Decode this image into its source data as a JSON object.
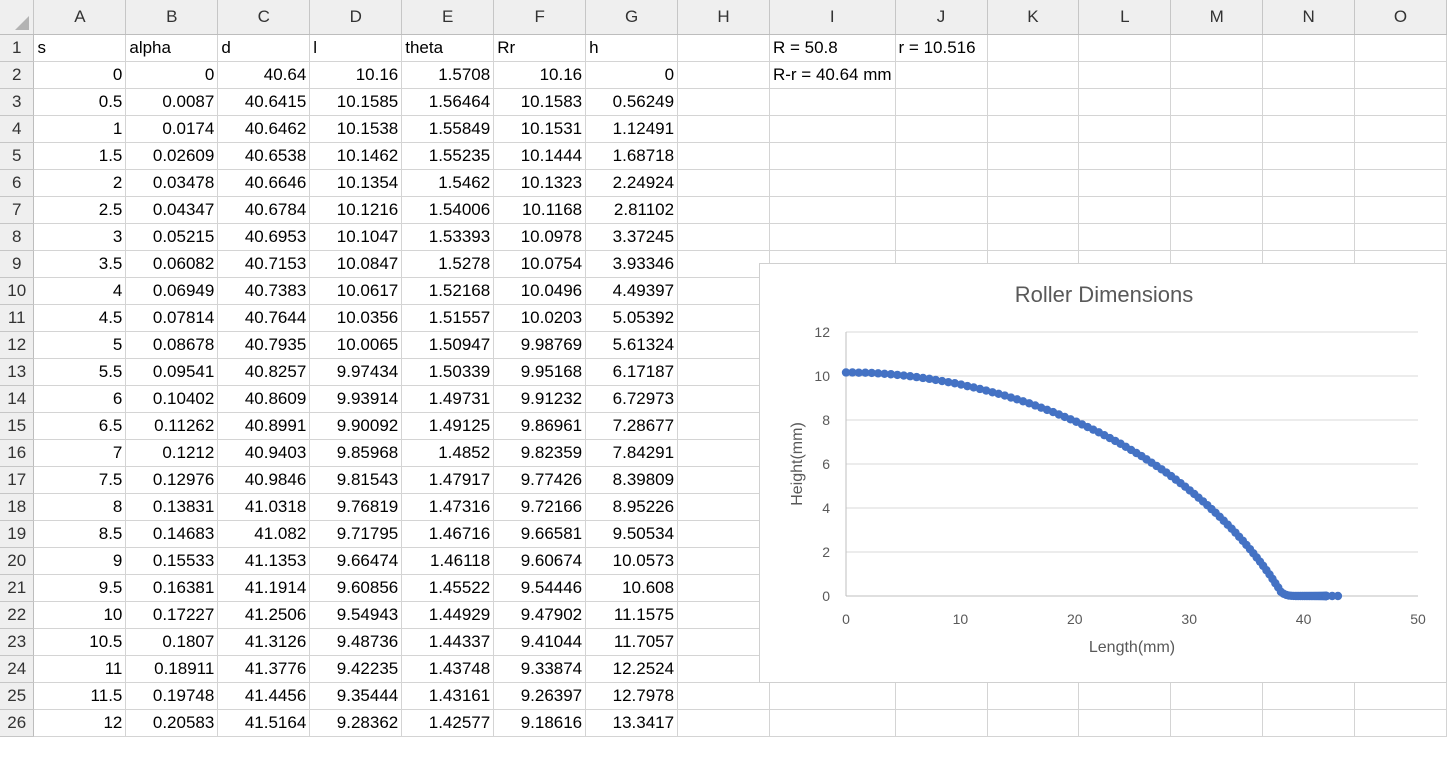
{
  "columns": [
    "A",
    "B",
    "C",
    "D",
    "E",
    "F",
    "G",
    "H",
    "I",
    "J",
    "K",
    "L",
    "M",
    "N",
    "O"
  ],
  "header_row": [
    "s",
    "alpha",
    "d",
    "l",
    "theta",
    "Rr",
    "h"
  ],
  "notes": {
    "I1": "R = 50.8",
    "J1": "r = 10.516",
    "I2": "R-r = 40.64 mm"
  },
  "rows": [
    [
      "0",
      "0",
      "40.64",
      "10.16",
      "1.5708",
      "10.16",
      "0"
    ],
    [
      "0.5",
      "0.0087",
      "40.6415",
      "10.1585",
      "1.56464",
      "10.1583",
      "0.56249"
    ],
    [
      "1",
      "0.0174",
      "40.6462",
      "10.1538",
      "1.55849",
      "10.1531",
      "1.12491"
    ],
    [
      "1.5",
      "0.02609",
      "40.6538",
      "10.1462",
      "1.55235",
      "10.1444",
      "1.68718"
    ],
    [
      "2",
      "0.03478",
      "40.6646",
      "10.1354",
      "1.5462",
      "10.1323",
      "2.24924"
    ],
    [
      "2.5",
      "0.04347",
      "40.6784",
      "10.1216",
      "1.54006",
      "10.1168",
      "2.81102"
    ],
    [
      "3",
      "0.05215",
      "40.6953",
      "10.1047",
      "1.53393",
      "10.0978",
      "3.37245"
    ],
    [
      "3.5",
      "0.06082",
      "40.7153",
      "10.0847",
      "1.5278",
      "10.0754",
      "3.93346"
    ],
    [
      "4",
      "0.06949",
      "40.7383",
      "10.0617",
      "1.52168",
      "10.0496",
      "4.49397"
    ],
    [
      "4.5",
      "0.07814",
      "40.7644",
      "10.0356",
      "1.51557",
      "10.0203",
      "5.05392"
    ],
    [
      "5",
      "0.08678",
      "40.7935",
      "10.0065",
      "1.50947",
      "9.98769",
      "5.61324"
    ],
    [
      "5.5",
      "0.09541",
      "40.8257",
      "9.97434",
      "1.50339",
      "9.95168",
      "6.17187"
    ],
    [
      "6",
      "0.10402",
      "40.8609",
      "9.93914",
      "1.49731",
      "9.91232",
      "6.72973"
    ],
    [
      "6.5",
      "0.11262",
      "40.8991",
      "9.90092",
      "1.49125",
      "9.86961",
      "7.28677"
    ],
    [
      "7",
      "0.1212",
      "40.9403",
      "9.85968",
      "1.4852",
      "9.82359",
      "7.84291"
    ],
    [
      "7.5",
      "0.12976",
      "40.9846",
      "9.81543",
      "1.47917",
      "9.77426",
      "8.39809"
    ],
    [
      "8",
      "0.13831",
      "41.0318",
      "9.76819",
      "1.47316",
      "9.72166",
      "8.95226"
    ],
    [
      "8.5",
      "0.14683",
      "41.082",
      "9.71795",
      "1.46716",
      "9.66581",
      "9.50534"
    ],
    [
      "9",
      "0.15533",
      "41.1353",
      "9.66474",
      "1.46118",
      "9.60674",
      "10.0573"
    ],
    [
      "9.5",
      "0.16381",
      "41.1914",
      "9.60856",
      "1.45522",
      "9.54446",
      "10.608"
    ],
    [
      "10",
      "0.17227",
      "41.2506",
      "9.54943",
      "1.44929",
      "9.47902",
      "11.1575"
    ],
    [
      "10.5",
      "0.1807",
      "41.3126",
      "9.48736",
      "1.44337",
      "9.41044",
      "11.7057"
    ],
    [
      "11",
      "0.18911",
      "41.3776",
      "9.42235",
      "1.43748",
      "9.33874",
      "12.2524"
    ],
    [
      "11.5",
      "0.19748",
      "41.4456",
      "9.35444",
      "1.43161",
      "9.26397",
      "12.7978"
    ],
    [
      "12",
      "0.20583",
      "41.5164",
      "9.28362",
      "1.42577",
      "9.18616",
      "13.3417"
    ]
  ],
  "chart_data": {
    "type": "scatter",
    "title": "Roller Dimensions",
    "xlabel": "Length(mm)",
    "ylabel": "Height(mm)",
    "xlim": [
      0,
      50
    ],
    "ylim": [
      0,
      12
    ],
    "xticks": [
      "0",
      "10",
      "20",
      "30",
      "40",
      "50"
    ],
    "yticks": [
      "0",
      "2",
      "4",
      "6",
      "8",
      "10",
      "12"
    ],
    "grid": true,
    "color": "#4472C4",
    "x": [
      0,
      0.56,
      1.12,
      1.69,
      2.25,
      2.81,
      3.37,
      3.93,
      4.49,
      5.05,
      5.61,
      6.17,
      6.73,
      7.29,
      7.84,
      8.4,
      8.95,
      9.51,
      10.06,
      10.61,
      11.16,
      11.71,
      12.25,
      12.8,
      13.34,
      13.88,
      14.42,
      14.95,
      15.48,
      16.01,
      16.54,
      17.06,
      17.58,
      18.1,
      18.61,
      19.12,
      19.63,
      20.13,
      20.63,
      21.12,
      21.61,
      22.1,
      22.58,
      23.06,
      23.53,
      24,
      24.46,
      24.92,
      25.38,
      25.83,
      26.27,
      26.71,
      27.15,
      27.58,
      28,
      28.42,
      28.83,
      29.24,
      29.65,
      30.05,
      30.44,
      30.82,
      31.21,
      31.58,
      31.95,
      32.31,
      32.67,
      33.02,
      33.37,
      33.71,
      34.04,
      34.37,
      34.69,
      35,
      35.31,
      35.61,
      35.9,
      36.19,
      36.47,
      36.75,
      37.02,
      37.28,
      37.53,
      37.78,
      38.02,
      38.26,
      38.49,
      38.71,
      38.92,
      39.13,
      39.33,
      39.52,
      39.71,
      39.89,
      40.06,
      40.22,
      40.38,
      40.53,
      40.67,
      40.81,
      40.94,
      41.06,
      41.17,
      41.28,
      41.38,
      41.47,
      41.55,
      41.63,
      41.7,
      41.76,
      41.81,
      41.86,
      41.9,
      41.93,
      41.96,
      41.97,
      41.98,
      41.99,
      42,
      42.5,
      43
    ],
    "y": [
      10.16,
      10.16,
      10.15,
      10.15,
      10.14,
      10.12,
      10.1,
      10.08,
      10.05,
      10.02,
      9.99,
      9.95,
      9.91,
      9.87,
      9.82,
      9.77,
      9.72,
      9.67,
      9.61,
      9.54,
      9.48,
      9.41,
      9.34,
      9.26,
      9.19,
      9.11,
      9.02,
      8.94,
      8.85,
      8.76,
      8.66,
      8.56,
      8.46,
      8.36,
      8.25,
      8.14,
      8.03,
      7.92,
      7.8,
      7.68,
      7.56,
      7.44,
      7.31,
      7.18,
      7.05,
      6.92,
      6.78,
      6.64,
      6.5,
      6.36,
      6.21,
      6.06,
      5.91,
      5.76,
      5.61,
      5.45,
      5.29,
      5.13,
      4.97,
      4.8,
      4.64,
      4.47,
      4.3,
      4.13,
      3.95,
      3.78,
      3.6,
      3.42,
      3.24,
      3.06,
      2.88,
      2.69,
      2.51,
      2.32,
      2.13,
      1.94,
      1.75,
      1.56,
      1.37,
      1.17,
      0.98,
      0.78,
      0.58,
      0.39,
      0.19,
      0.1,
      0.05,
      0.02,
      0.01,
      0.005,
      0,
      0,
      0,
      0,
      0,
      0,
      0,
      0,
      0,
      0,
      0,
      0,
      0,
      0,
      0,
      0,
      0,
      0,
      0,
      0,
      0,
      0,
      0,
      0,
      0,
      0,
      0,
      0,
      0,
      0,
      0,
      0,
      0
    ]
  }
}
